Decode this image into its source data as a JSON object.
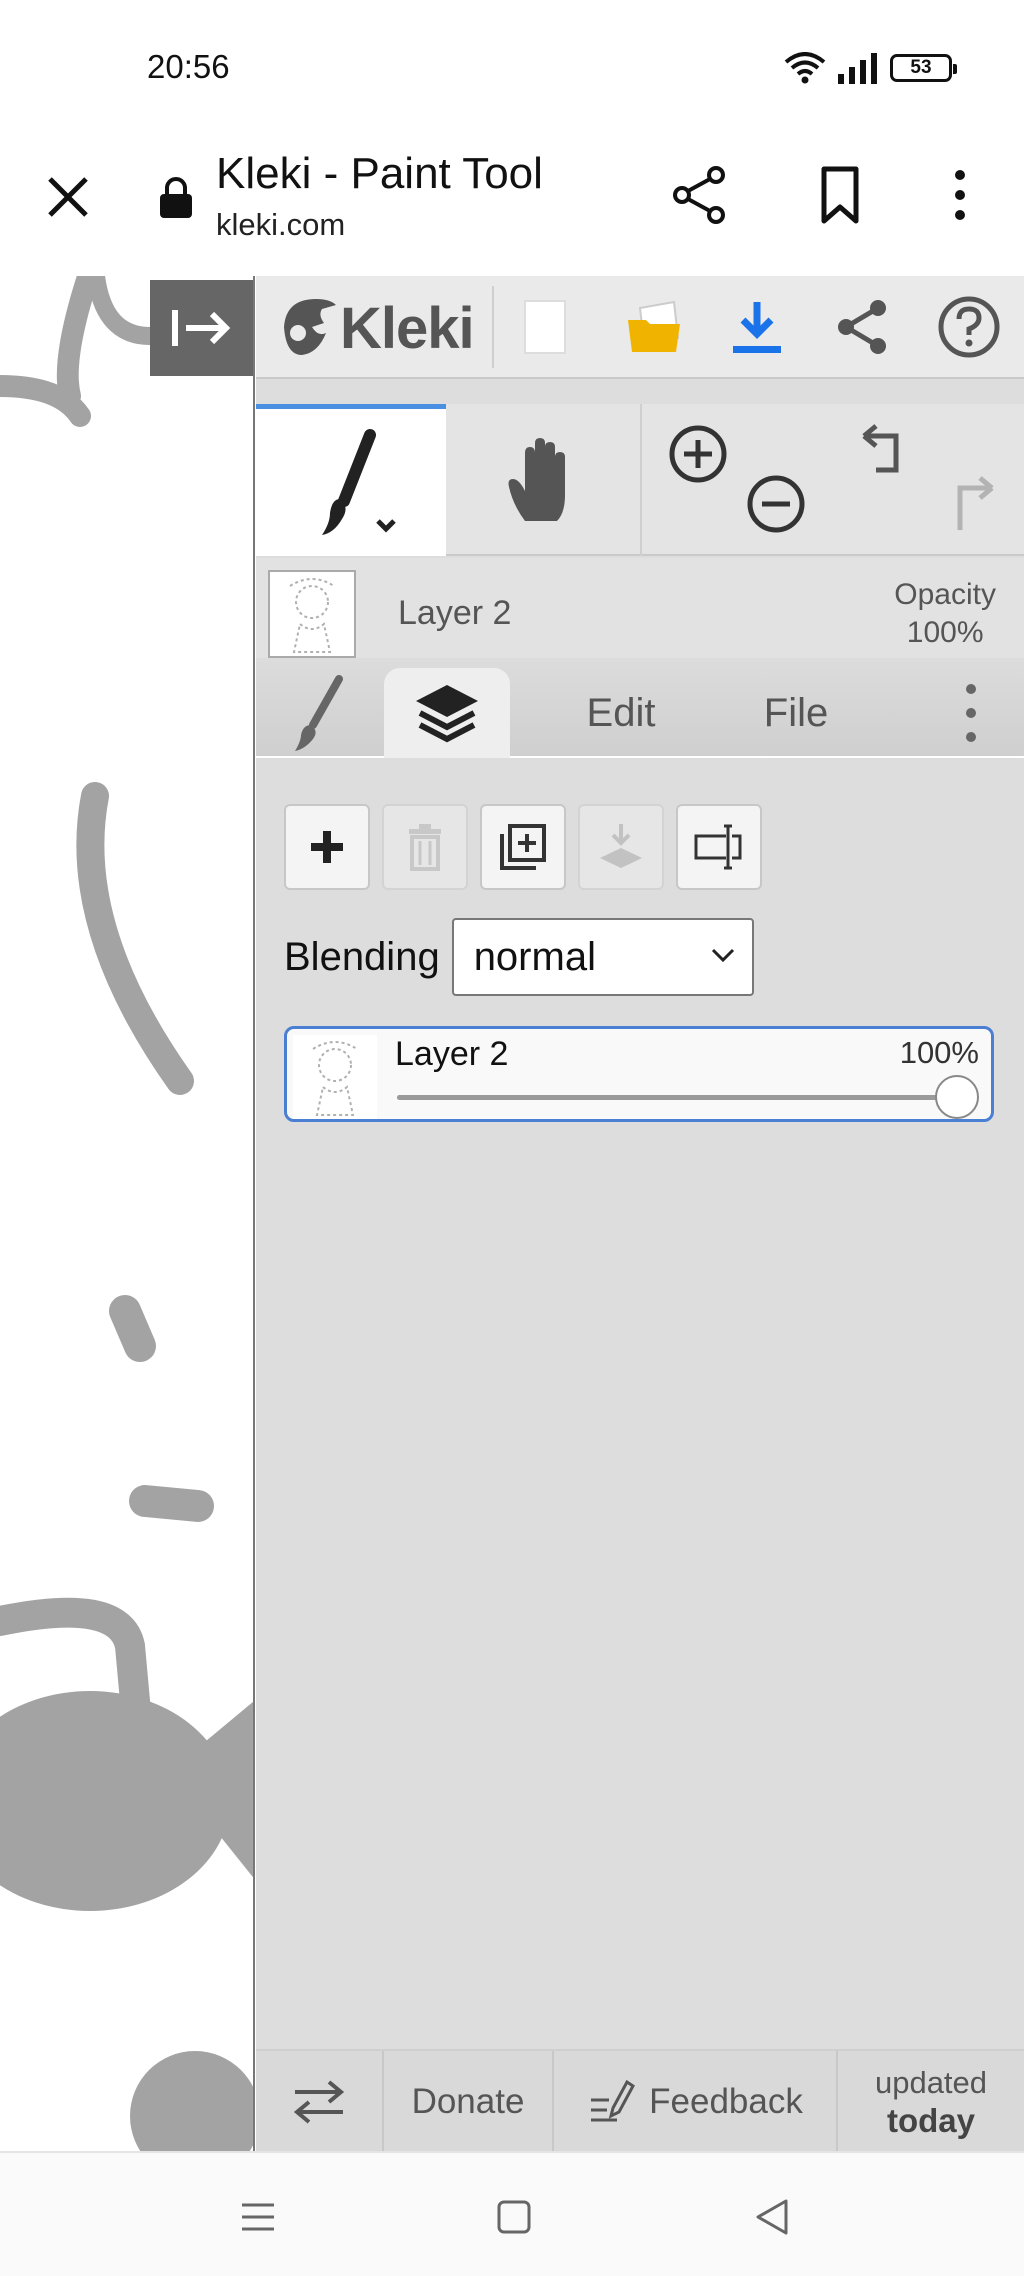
{
  "status_bar": {
    "time": "20:56",
    "battery": "53",
    "icons": [
      "wifi-icon",
      "signal-icon",
      "battery-icon"
    ]
  },
  "browser": {
    "title": "Kleki - Paint Tool",
    "url": "kleki.com",
    "icons": [
      "close-icon",
      "lock-icon",
      "share-icon",
      "bookmark-icon",
      "more-vert-icon"
    ]
  },
  "app": {
    "logo_text": "Kleki",
    "header_icons": [
      "new-image-icon",
      "open-folder-icon",
      "download-icon",
      "share-icon",
      "help-icon"
    ],
    "tools": [
      "brush-tool-icon",
      "hand-tool-icon",
      "zoom-in-icon",
      "zoom-out-icon",
      "undo-icon",
      "redo-icon"
    ],
    "current_layer": {
      "name": "Layer 2",
      "opacity_label": "Opacity",
      "opacity_value": "100%"
    },
    "tabs": [
      {
        "icon": "brush-tab-icon"
      },
      {
        "icon": "layers-tab-icon",
        "active": true
      },
      {
        "label": "Edit"
      },
      {
        "label": "File"
      },
      {
        "icon": "more-tab-icon"
      }
    ],
    "layer_tools": [
      {
        "icon": "add-layer-icon",
        "enabled": true
      },
      {
        "icon": "delete-layer-icon",
        "enabled": false
      },
      {
        "icon": "duplicate-layer-icon",
        "enabled": true
      },
      {
        "icon": "merge-down-icon",
        "enabled": false
      },
      {
        "icon": "rename-layer-icon",
        "enabled": true
      }
    ],
    "blending": {
      "label": "Blending",
      "value": "normal"
    },
    "layers": [
      {
        "name": "Layer 2",
        "opacity": "100%",
        "opacity_fraction": 1.0,
        "selected": true
      }
    ],
    "footer": {
      "swap_icon": "swap-icon",
      "donate": "Donate",
      "feedback": "Feedback",
      "updated_line1": "updated",
      "updated_line2": "today"
    }
  },
  "navbar": {
    "icons": [
      "menu-nav-icon",
      "home-nav-icon",
      "back-nav-icon"
    ]
  },
  "colors": {
    "accent": "#4a90e2",
    "download": "#1a73e8",
    "folder": "#f0b400",
    "panel_bg": "#dddddd",
    "canvas_stroke": "#a3a3a3"
  }
}
